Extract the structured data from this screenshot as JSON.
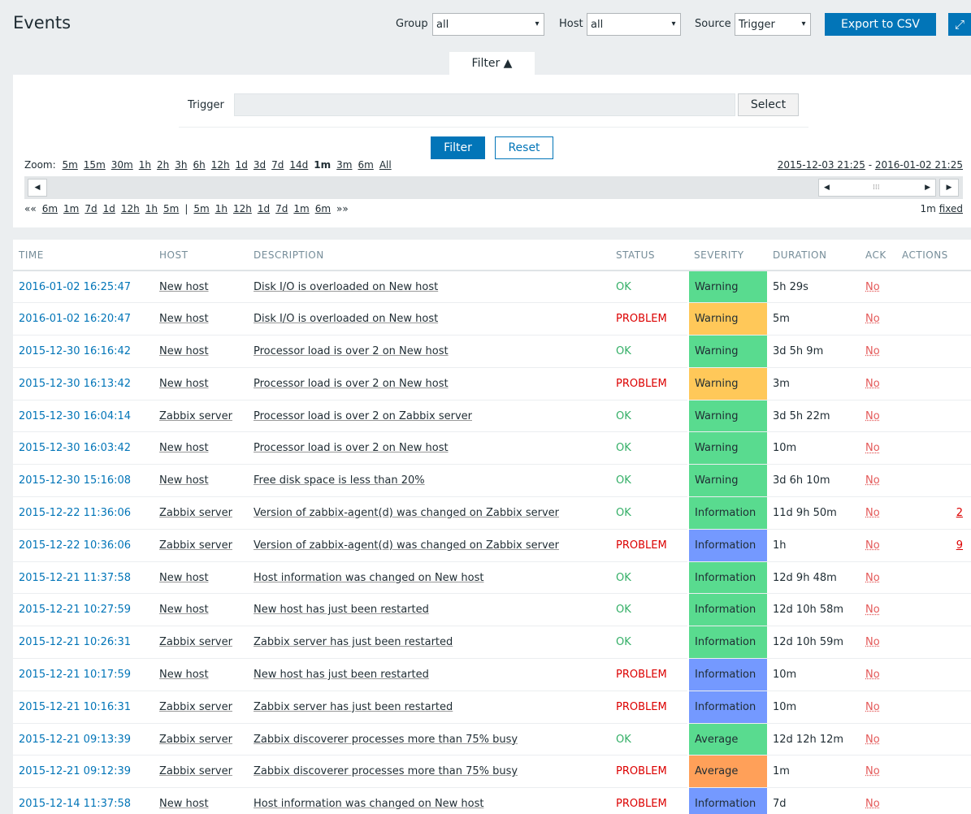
{
  "header": {
    "title": "Events",
    "group_label": "Group",
    "group_value": "all",
    "host_label": "Host",
    "host_value": "all",
    "source_label": "Source",
    "source_value": "Trigger",
    "export_label": "Export to CSV",
    "fullscreen_icon": "fullscreen-icon"
  },
  "filter": {
    "tab_label": "Filter ▲",
    "trigger_label": "Trigger",
    "select_label": "Select",
    "filter_button": "Filter",
    "reset_button": "Reset"
  },
  "timeline": {
    "zoom_label": "Zoom:",
    "zoom": [
      "5m",
      "15m",
      "30m",
      "1h",
      "2h",
      "3h",
      "6h",
      "12h",
      "1d",
      "3d",
      "7d",
      "14d",
      "1m",
      "3m",
      "6m",
      "All"
    ],
    "zoom_active": "1m",
    "period_from": "2015-12-03 21:25",
    "period_sep": " - ",
    "period_to": "2016-01-02 21:25",
    "nav_back_prefix": "««",
    "nav_back": [
      "6m",
      "1m",
      "7d",
      "1d",
      "12h",
      "1h",
      "5m"
    ],
    "nav_sep": "|",
    "nav_fwd": [
      "5m",
      "1h",
      "12h",
      "1d",
      "7d",
      "1m",
      "6m"
    ],
    "nav_fwd_suffix": "»»",
    "period_size": "1m",
    "fixed_label": "fixed"
  },
  "table": {
    "columns": [
      "TIME",
      "HOST",
      "DESCRIPTION",
      "STATUS",
      "SEVERITY",
      "DURATION",
      "ACK",
      "ACTIONS"
    ],
    "rows": [
      {
        "time": "2016-01-02 16:25:47",
        "host": "New host",
        "desc": "Disk I/O is overloaded on New host",
        "status": "OK",
        "severity": "Warning",
        "sev_color": "#59db8f",
        "duration": "5h 29s",
        "ack": "No",
        "actions": ""
      },
      {
        "time": "2016-01-02 16:20:47",
        "host": "New host",
        "desc": "Disk I/O is overloaded on New host",
        "status": "PROBLEM",
        "severity": "Warning",
        "sev_color": "#ffc859",
        "duration": "5m",
        "ack": "No",
        "actions": ""
      },
      {
        "time": "2015-12-30 16:16:42",
        "host": "New host",
        "desc": "Processor load is over 2 on New host",
        "status": "OK",
        "severity": "Warning",
        "sev_color": "#59db8f",
        "duration": "3d 5h 9m",
        "ack": "No",
        "actions": ""
      },
      {
        "time": "2015-12-30 16:13:42",
        "host": "New host",
        "desc": "Processor load is over 2 on New host",
        "status": "PROBLEM",
        "severity": "Warning",
        "sev_color": "#ffc859",
        "duration": "3m",
        "ack": "No",
        "actions": ""
      },
      {
        "time": "2015-12-30 16:04:14",
        "host": "Zabbix server",
        "desc": "Processor load is over 2 on Zabbix server",
        "status": "OK",
        "severity": "Warning",
        "sev_color": "#59db8f",
        "duration": "3d 5h 22m",
        "ack": "No",
        "actions": ""
      },
      {
        "time": "2015-12-30 16:03:42",
        "host": "New host",
        "desc": "Processor load is over 2 on New host",
        "status": "OK",
        "severity": "Warning",
        "sev_color": "#59db8f",
        "duration": "10m",
        "ack": "No",
        "actions": ""
      },
      {
        "time": "2015-12-30 15:16:08",
        "host": "New host",
        "desc": "Free disk space is less than 20%",
        "status": "OK",
        "severity": "Warning",
        "sev_color": "#59db8f",
        "duration": "3d 6h 10m",
        "ack": "No",
        "actions": ""
      },
      {
        "time": "2015-12-22 11:36:06",
        "host": "Zabbix server",
        "desc": "Version of zabbix-agent(d) was changed on Zabbix server",
        "status": "OK",
        "severity": "Information",
        "sev_color": "#59db8f",
        "duration": "11d 9h 50m",
        "ack": "No",
        "actions": "2"
      },
      {
        "time": "2015-12-22 10:36:06",
        "host": "Zabbix server",
        "desc": "Version of zabbix-agent(d) was changed on Zabbix server",
        "status": "PROBLEM",
        "severity": "Information",
        "sev_color": "#7499ff",
        "duration": "1h",
        "ack": "No",
        "actions": "9"
      },
      {
        "time": "2015-12-21 11:37:58",
        "host": "New host",
        "desc": "Host information was changed on New host",
        "status": "OK",
        "severity": "Information",
        "sev_color": "#59db8f",
        "duration": "12d 9h 48m",
        "ack": "No",
        "actions": ""
      },
      {
        "time": "2015-12-21 10:27:59",
        "host": "New host",
        "desc": "New host has just been restarted",
        "status": "OK",
        "severity": "Information",
        "sev_color": "#59db8f",
        "duration": "12d 10h 58m",
        "ack": "No",
        "actions": ""
      },
      {
        "time": "2015-12-21 10:26:31",
        "host": "Zabbix server",
        "desc": "Zabbix server has just been restarted",
        "status": "OK",
        "severity": "Information",
        "sev_color": "#59db8f",
        "duration": "12d 10h 59m",
        "ack": "No",
        "actions": ""
      },
      {
        "time": "2015-12-21 10:17:59",
        "host": "New host",
        "desc": "New host has just been restarted",
        "status": "PROBLEM",
        "severity": "Information",
        "sev_color": "#7499ff",
        "duration": "10m",
        "ack": "No",
        "actions": ""
      },
      {
        "time": "2015-12-21 10:16:31",
        "host": "Zabbix server",
        "desc": "Zabbix server has just been restarted",
        "status": "PROBLEM",
        "severity": "Information",
        "sev_color": "#7499ff",
        "duration": "10m",
        "ack": "No",
        "actions": ""
      },
      {
        "time": "2015-12-21 09:13:39",
        "host": "Zabbix server",
        "desc": "Zabbix discoverer processes more than 75% busy",
        "status": "OK",
        "severity": "Average",
        "sev_color": "#59db8f",
        "duration": "12d 12h 12m",
        "ack": "No",
        "actions": ""
      },
      {
        "time": "2015-12-21 09:12:39",
        "host": "Zabbix server",
        "desc": "Zabbix discoverer processes more than 75% busy",
        "status": "PROBLEM",
        "severity": "Average",
        "sev_color": "#ffa059",
        "duration": "1m",
        "ack": "No",
        "actions": ""
      },
      {
        "time": "2015-12-14 11:37:58",
        "host": "New host",
        "desc": "Host information was changed on New host",
        "status": "PROBLEM",
        "severity": "Information",
        "sev_color": "#7499ff",
        "duration": "7d",
        "ack": "No",
        "actions": ""
      }
    ]
  }
}
